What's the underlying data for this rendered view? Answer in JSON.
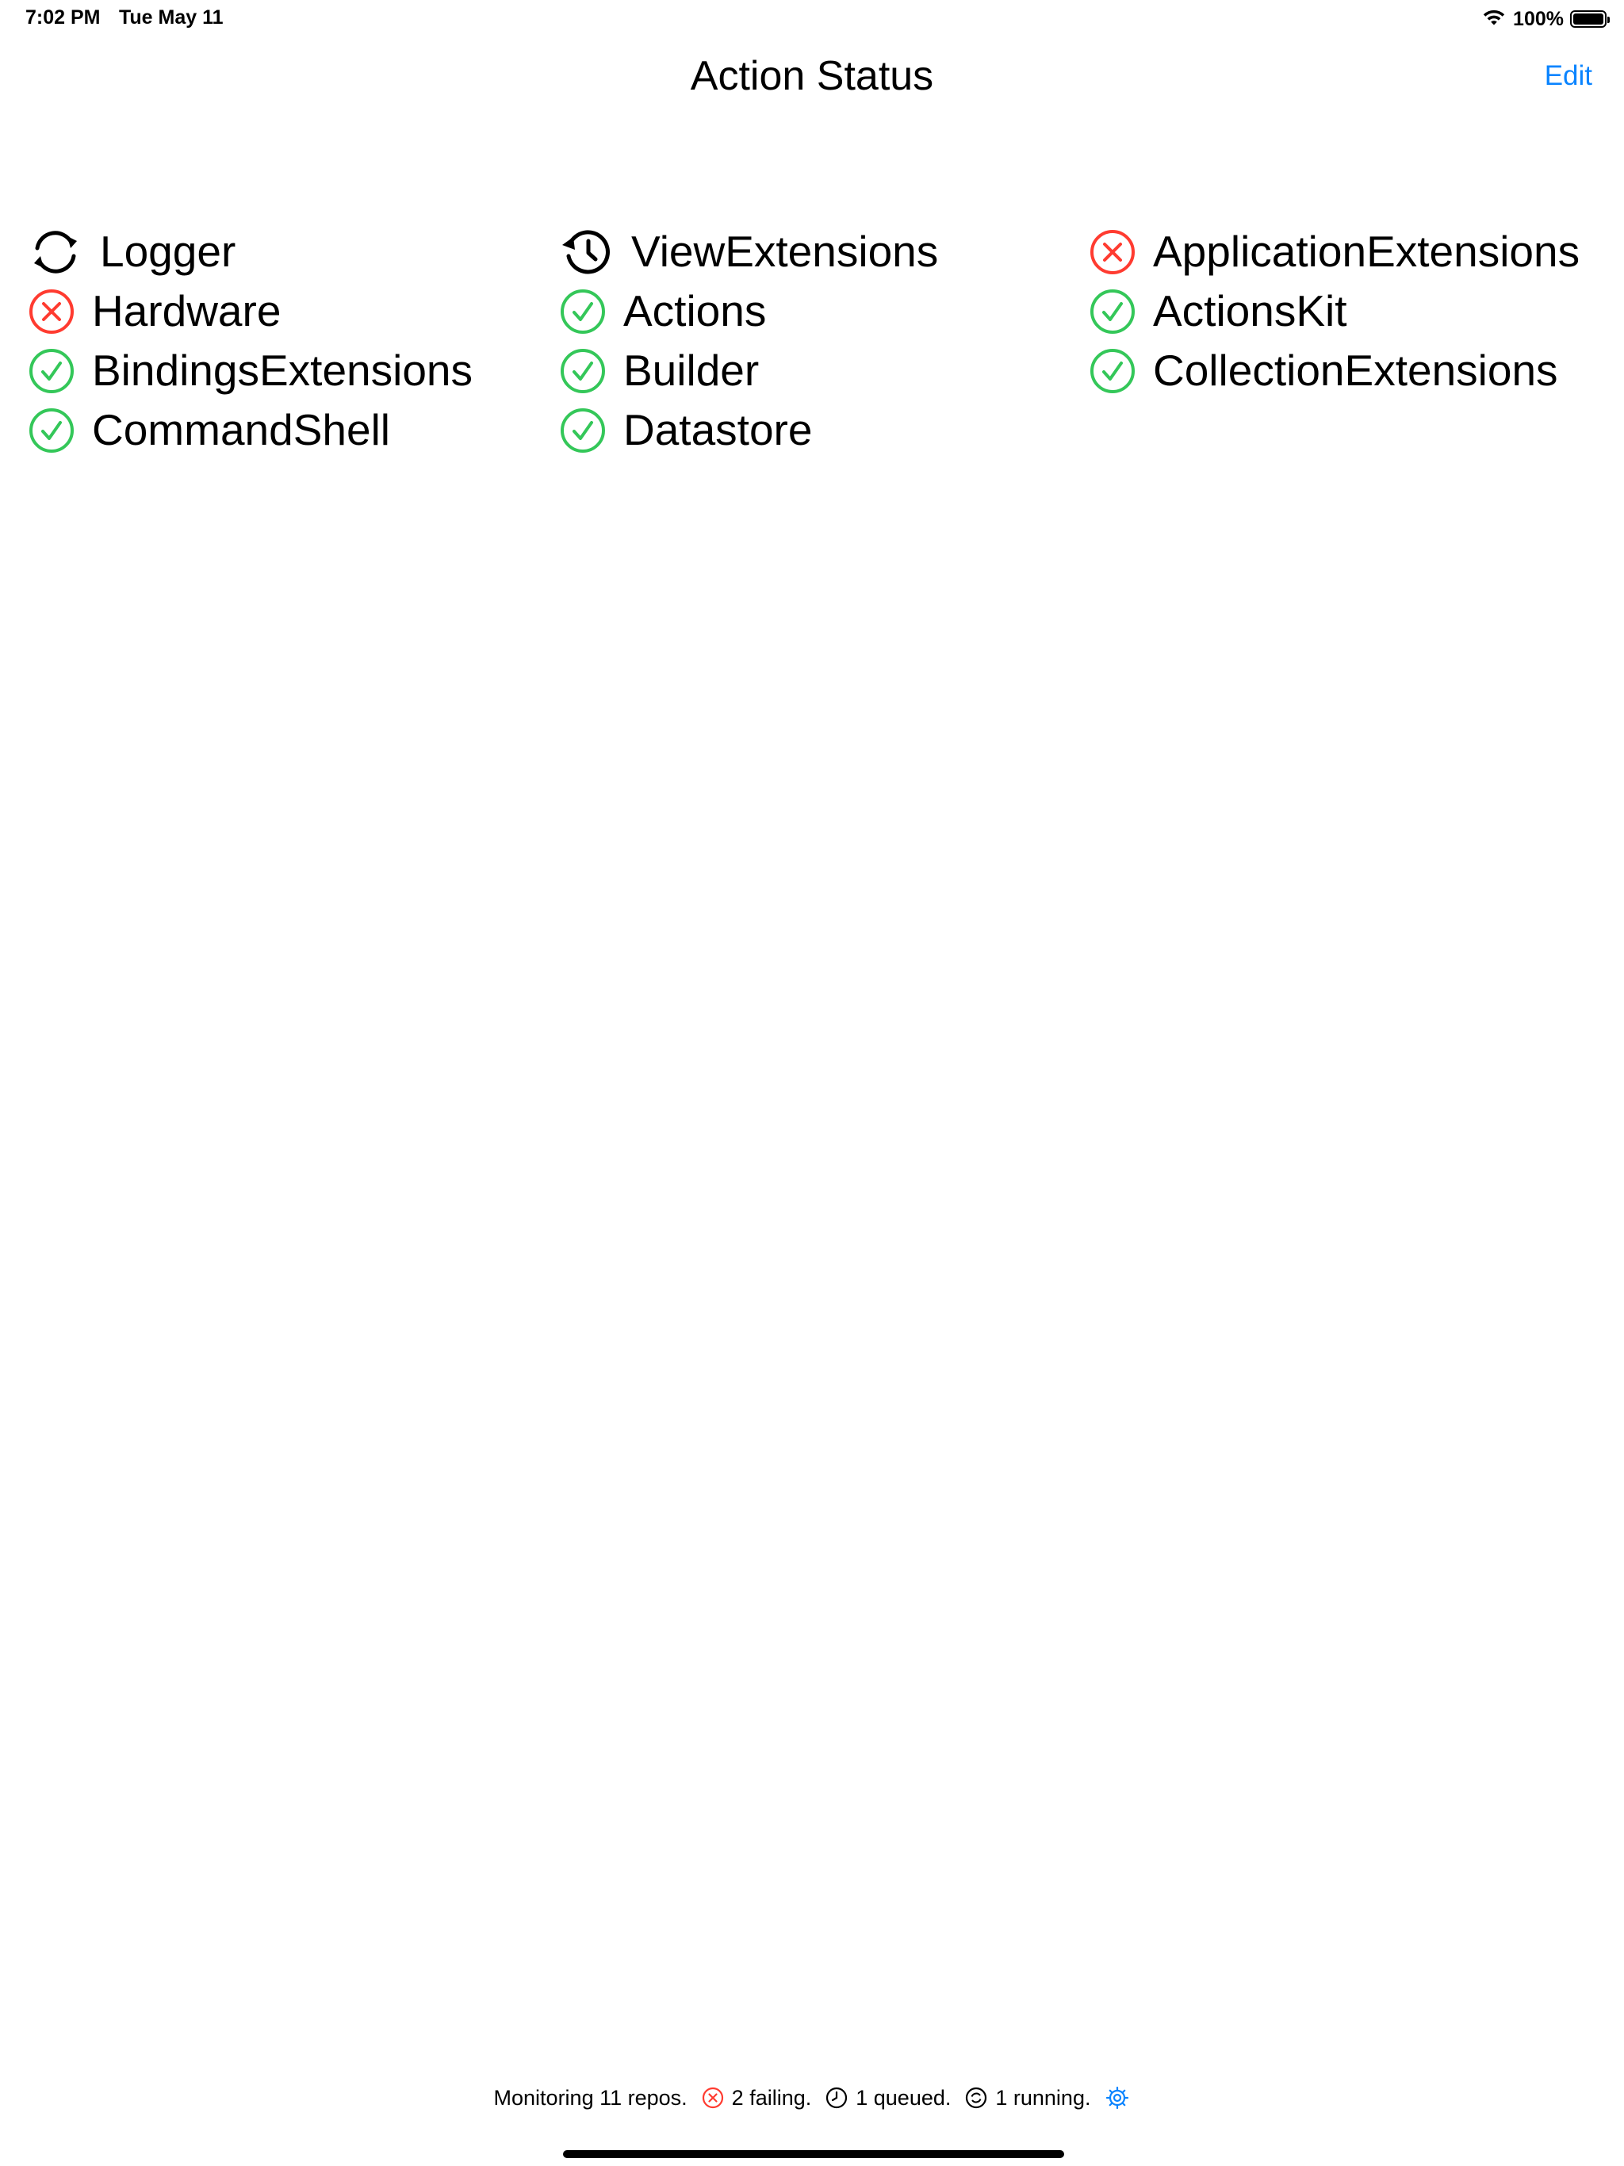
{
  "status_bar": {
    "time": "7:02 PM",
    "date": "Tue May 11",
    "battery_percent": "100%",
    "battery_level": 1.0,
    "wifi_icon": "wifi-icon"
  },
  "nav": {
    "title": "Action Status",
    "edit_label": "Edit"
  },
  "colors": {
    "accent": "#0a84ff",
    "success": "#34c759",
    "failure": "#ff3b30",
    "pending": "#000000"
  },
  "repos": {
    "column1": [
      {
        "name": "Logger",
        "status": "running",
        "icon": "arrows-circle-icon"
      },
      {
        "name": "Hardware",
        "status": "failing",
        "icon": "x-circle-icon"
      },
      {
        "name": "BindingsExtensions",
        "status": "passing",
        "icon": "check-circle-icon"
      },
      {
        "name": "CommandShell",
        "status": "passing",
        "icon": "check-circle-icon"
      }
    ],
    "column2": [
      {
        "name": "ViewExtensions",
        "status": "queued",
        "icon": "clock-history-icon"
      },
      {
        "name": "Actions",
        "status": "passing",
        "icon": "check-circle-icon"
      },
      {
        "name": "Builder",
        "status": "passing",
        "icon": "check-circle-icon"
      },
      {
        "name": "Datastore",
        "status": "passing",
        "icon": "check-circle-icon"
      }
    ],
    "column3": [
      {
        "name": "ApplicationExtensions",
        "status": "failing",
        "icon": "x-circle-icon"
      },
      {
        "name": "ActionsKit",
        "status": "passing",
        "icon": "check-circle-icon"
      },
      {
        "name": "CollectionExtensions",
        "status": "passing",
        "icon": "check-circle-icon"
      }
    ]
  },
  "footer": {
    "monitoring": "Monitoring 11 repos.",
    "failing": "2 failing.",
    "queued": "1 queued.",
    "running": "1 running.",
    "settings_icon": "gear-icon"
  }
}
